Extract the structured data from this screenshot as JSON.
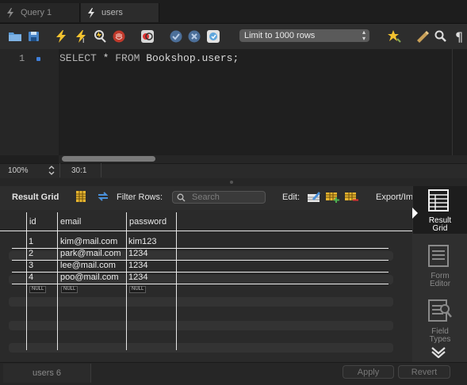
{
  "tabs": [
    {
      "label": "Query 1",
      "active": false
    },
    {
      "label": "users",
      "active": true
    }
  ],
  "toolbar": {
    "limit_label": "Limit to 1000 rows",
    "icons": [
      "open-folder-icon",
      "save-icon",
      "execute-icon",
      "execute-current-icon",
      "explain-icon",
      "stop-icon",
      "toggle-error-icon",
      "commit-icon",
      "rollback-icon",
      "autocommit-icon",
      "beautify-icon",
      "find-icon",
      "invisibles-icon"
    ]
  },
  "editor": {
    "line_number": "1",
    "code": {
      "kw1": "SELECT",
      "rest1": " * ",
      "kw2": "FROM",
      "rest2": " Bookshop.users;"
    }
  },
  "status": {
    "zoom": "100%",
    "cursor": "30:1"
  },
  "result_toolbar": {
    "result_grid_label": "Result Grid",
    "filter_label": "Filter Rows:",
    "search_placeholder": "Search",
    "edit_label": "Edit:",
    "export_label": "Export/Im"
  },
  "grid": {
    "columns": [
      "id",
      "email",
      "password"
    ],
    "rows": [
      [
        "1",
        "kim@mail.com",
        "kim123"
      ],
      [
        "2",
        "park@mail.com",
        "1234"
      ],
      [
        "3",
        "lee@mail.com",
        "1234"
      ],
      [
        "4",
        "poo@mail.com",
        "1234"
      ]
    ],
    "null_label": "NULL"
  },
  "side_panel": {
    "result_grid": [
      "Result",
      "Grid"
    ],
    "form_editor": [
      "Form",
      "Editor"
    ],
    "field_types": [
      "Field",
      "Types"
    ]
  },
  "bottom": {
    "result_tab": "users 6",
    "apply": "Apply",
    "revert": "Revert"
  },
  "colors": {
    "accent": "#3f7fd9",
    "background": "#2b2b2b"
  }
}
